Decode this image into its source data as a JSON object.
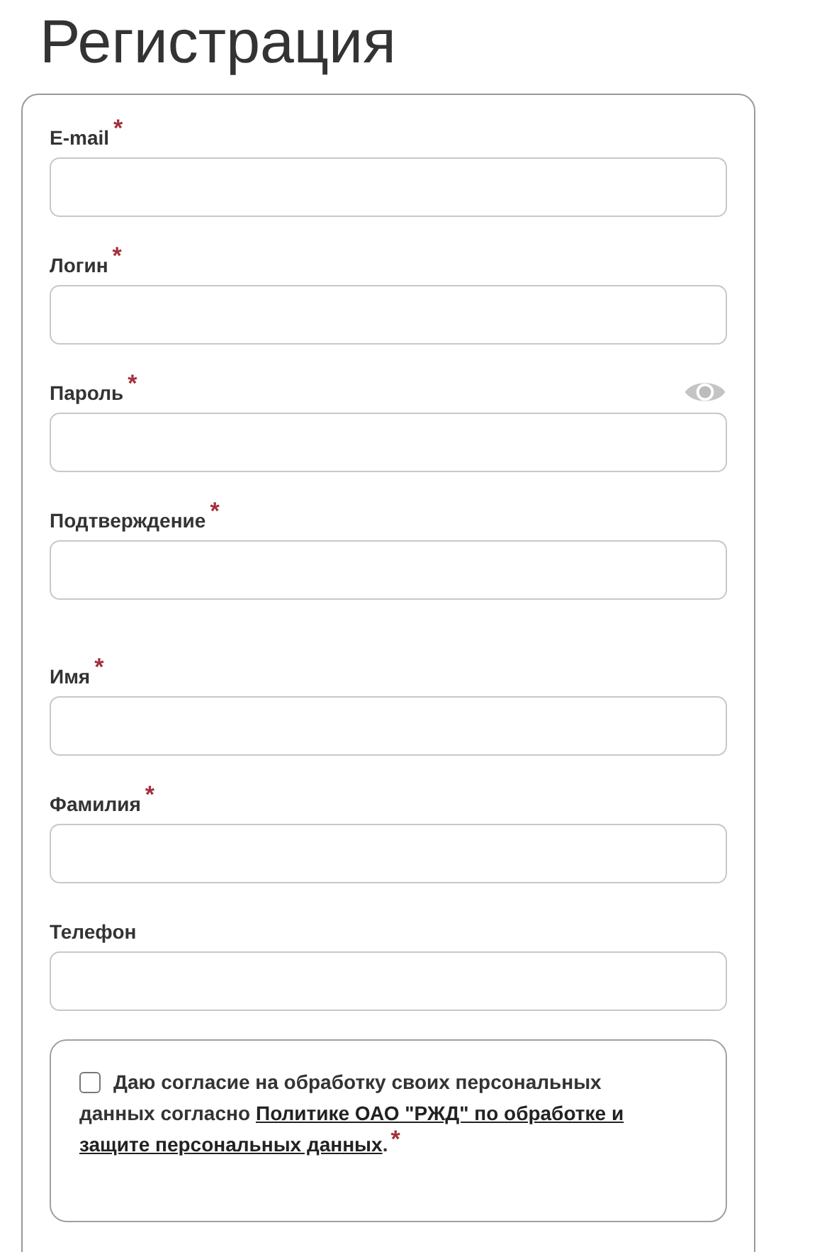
{
  "title": "Регистрация",
  "account_fields": [
    {
      "label": "E-mail",
      "required_mark": "*"
    },
    {
      "label": "Логин",
      "required_mark": "*"
    },
    {
      "label": "Пароль",
      "required_mark": "*",
      "show_password_toggle": true
    },
    {
      "label": "Подтверждение",
      "required_mark": "*"
    }
  ],
  "personal_fields": [
    {
      "label": "Имя",
      "required_mark": "*"
    },
    {
      "label": "Фамилия",
      "required_mark": "*"
    },
    {
      "label": "Телефон"
    }
  ],
  "consent": {
    "checked": false,
    "line_1": "Даю согласие на обработку своих персональных",
    "line_2_text": "данных согласно",
    "line_2_link": "Политике ОАО \"РЖД\" по обработке и",
    "line_3_link": "защите персональных данных",
    "line_3_text": ".",
    "required_mark": "*"
  }
}
